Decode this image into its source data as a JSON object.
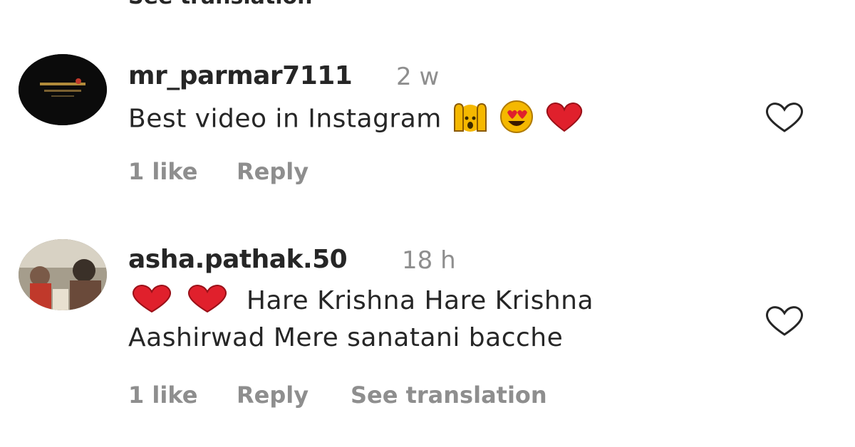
{
  "top_cut": {
    "see_translation": "See translation"
  },
  "comments": [
    {
      "username": "mr_parmar7111",
      "time": "2 w",
      "text": "Best video in Instagram",
      "emojis": [
        "raising-hands-icon",
        "heart-eyes-face-icon",
        "red-heart-icon"
      ],
      "likes": "1 like",
      "reply": "Reply"
    },
    {
      "username": "asha.pathak.50",
      "time": "18 h",
      "emojis": [
        "red-heart-icon",
        "red-heart-icon"
      ],
      "text_line1": "Hare Krishna Hare Krishna",
      "text_line2": "Aashirwad Mere sanatani bacche",
      "likes": "1 like",
      "reply": "Reply",
      "see_translation": "See translation"
    }
  ],
  "colors": {
    "text": "#262626",
    "secondary": "#8e8e8e",
    "heart_red": "#e0202c",
    "emoji_yellow": "#f5b800"
  }
}
